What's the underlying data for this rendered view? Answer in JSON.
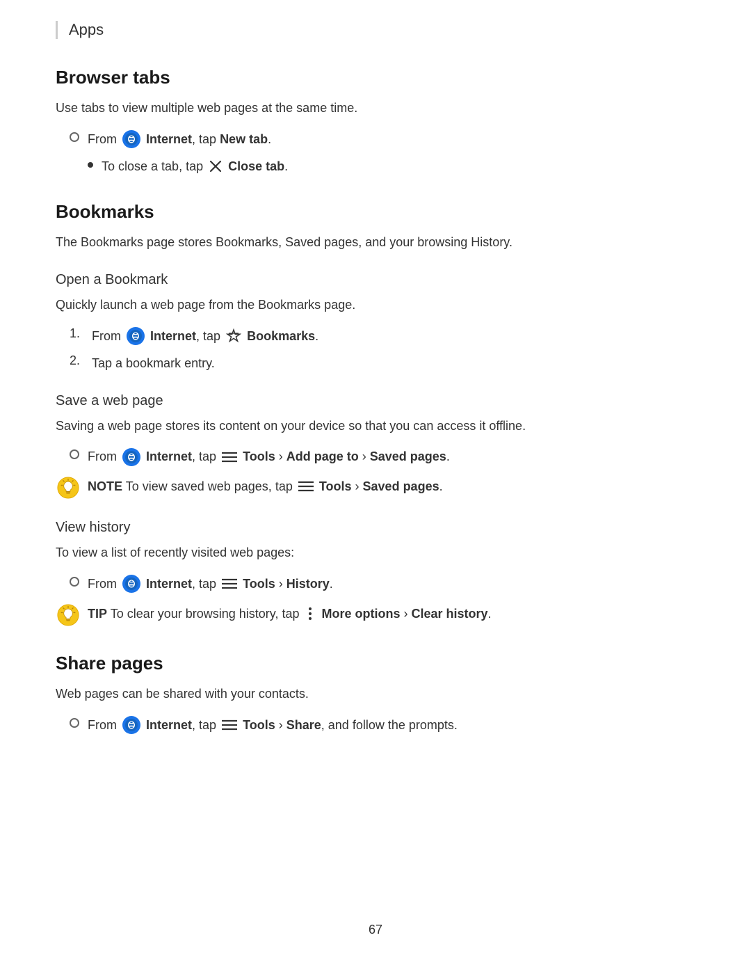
{
  "breadcrumb": {
    "text": "Apps"
  },
  "page_number": "67",
  "sections": {
    "browser_tabs": {
      "header": "Browser tabs",
      "description": "Use tabs to view multiple web pages at the same time.",
      "step1": {
        "prefix": "From",
        "app_name": "Internet",
        "action": ", tap",
        "bold_action": "New tab",
        "end": "."
      },
      "sub_step1": {
        "prefix": "To close a tab, tap",
        "bold_action": "Close tab",
        "end": "."
      }
    },
    "bookmarks": {
      "header": "Bookmarks",
      "description": "The Bookmarks page stores Bookmarks, Saved pages, and your browsing History.",
      "open_bookmark": {
        "subheader": "Open a Bookmark",
        "description": "Quickly launch a web page from the Bookmarks page.",
        "step1_prefix": "From",
        "step1_app": "Internet",
        "step1_action": ", tap",
        "step1_bold": "Bookmarks",
        "step1_end": ".",
        "step2": "Tap a bookmark entry."
      },
      "save_web_page": {
        "subheader": "Save a web page",
        "description": "Saving a web page stores its content on your device so that you can access it offline.",
        "step_prefix": "From",
        "step_app": "Internet",
        "step_action": ", tap",
        "step_bold1": "Tools",
        "step_arrow1": " › ",
        "step_bold2": "Add page to",
        "step_arrow2": " › ",
        "step_bold3": "Saved pages",
        "step_end": ".",
        "note_label": "NOTE",
        "note_text": "To view saved web pages, tap",
        "note_bold1": "Tools",
        "note_arrow": " › ",
        "note_bold2": "Saved pages",
        "note_end": "."
      },
      "view_history": {
        "subheader": "View history",
        "description": "To view a list of recently visited web pages:",
        "step_prefix": "From",
        "step_app": "Internet",
        "step_action": ", tap",
        "step_bold1": "Tools",
        "step_arrow": " › ",
        "step_bold2": "History",
        "step_end": ".",
        "tip_label": "TIP",
        "tip_text": "To clear your browsing history, tap",
        "tip_bold1": "More options",
        "tip_arrow": " › ",
        "tip_bold2": "Clear history",
        "tip_end": "."
      }
    },
    "share_pages": {
      "header": "Share pages",
      "description": "Web pages can be shared with your contacts.",
      "step_prefix": "From",
      "step_app": "Internet",
      "step_action": ", tap",
      "step_bold1": "Tools",
      "step_arrow": " › ",
      "step_bold2": "Share",
      "step_end": ", and follow the prompts."
    }
  }
}
